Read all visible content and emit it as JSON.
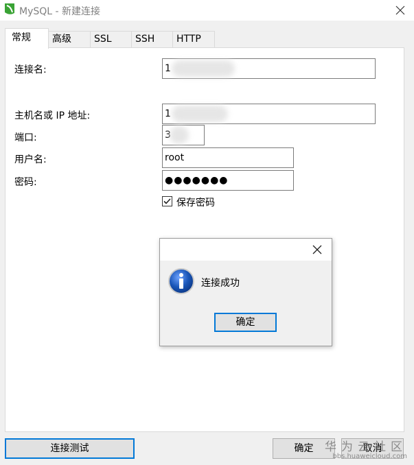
{
  "window": {
    "title": "MySQL - 新建连接",
    "icon": "navicat-leaf-icon",
    "close_icon": "close-icon"
  },
  "tabs": [
    {
      "label": "常规",
      "active": true
    },
    {
      "label": "高级",
      "active": false
    },
    {
      "label": "SSL",
      "active": false
    },
    {
      "label": "SSH",
      "active": false
    },
    {
      "label": "HTTP",
      "active": false
    }
  ],
  "form": {
    "connection_name_label": "连接名:",
    "connection_name_value": "1",
    "host_label": "主机名或 IP 地址:",
    "host_value": "1",
    "port_label": "端口:",
    "port_value": "3",
    "username_label": "用户名:",
    "username_value": "root",
    "password_label": "密码:",
    "password_value": "●●●●●●●",
    "save_password_label": "保存密码",
    "save_password_checked": true
  },
  "dialog": {
    "message": "连接成功",
    "ok_label": "确定",
    "icon": "info-icon"
  },
  "buttons": {
    "test_connection": "连接测试",
    "ok": "确定",
    "cancel": "取消"
  },
  "watermark": {
    "main": "华为云社区",
    "sub": "bbs.huaweicloud.com"
  },
  "colors": {
    "focus_blue": "#0078d7",
    "app_icon_green": "#3aa335",
    "info_blue": "#1a56b8"
  }
}
